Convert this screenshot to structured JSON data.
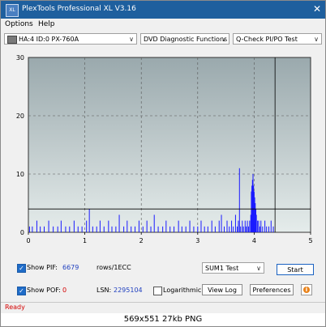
{
  "window": {
    "title": "PlexTools Professional XL V3.16",
    "icon_text": "XL",
    "close_glyph": "✕"
  },
  "menu": {
    "items": [
      "Options",
      "Help"
    ]
  },
  "toolbar": {
    "drive": "HA:4 ID:0  PX-760A",
    "function": "DVD Diagnostic Functions",
    "test": "Q-Check PI/PO Test",
    "arrow": "∨"
  },
  "chart_data": {
    "type": "bar",
    "x_ticks": [
      "0",
      "1",
      "2",
      "3",
      "4",
      "5"
    ],
    "y_ticks": [
      "0",
      "10",
      "20",
      "30"
    ],
    "xlim": [
      0,
      5
    ],
    "ylim": [
      0,
      30
    ],
    "grid": true,
    "reference_line": 4,
    "end_marker_x": 4.37,
    "colors": {
      "bars": "#1a1aff",
      "plot_bg_top": "#9aa9ad",
      "plot_bg_bottom": "#e5eceb",
      "grid": "#555555",
      "ref_line": "#000000"
    },
    "series": [
      {
        "points": [
          [
            0.02,
            1
          ],
          [
            0.07,
            1
          ],
          [
            0.15,
            2
          ],
          [
            0.21,
            1
          ],
          [
            0.28,
            1
          ],
          [
            0.36,
            2
          ],
          [
            0.44,
            1
          ],
          [
            0.52,
            1
          ],
          [
            0.58,
            2
          ],
          [
            0.66,
            1
          ],
          [
            0.73,
            1
          ],
          [
            0.81,
            2
          ],
          [
            0.88,
            1
          ],
          [
            0.95,
            1
          ],
          [
            1.03,
            2
          ],
          [
            1.08,
            4
          ],
          [
            1.14,
            1
          ],
          [
            1.21,
            1
          ],
          [
            1.27,
            2
          ],
          [
            1.34,
            1
          ],
          [
            1.42,
            2
          ],
          [
            1.48,
            1
          ],
          [
            1.55,
            1
          ],
          [
            1.61,
            3
          ],
          [
            1.69,
            1
          ],
          [
            1.75,
            2
          ],
          [
            1.82,
            1
          ],
          [
            1.89,
            1
          ],
          [
            1.96,
            2
          ],
          [
            2.03,
            1
          ],
          [
            2.1,
            2
          ],
          [
            2.17,
            1
          ],
          [
            2.23,
            3
          ],
          [
            2.3,
            1
          ],
          [
            2.38,
            1
          ],
          [
            2.44,
            2
          ],
          [
            2.51,
            1
          ],
          [
            2.58,
            1
          ],
          [
            2.66,
            2
          ],
          [
            2.72,
            1
          ],
          [
            2.79,
            1
          ],
          [
            2.86,
            2
          ],
          [
            2.93,
            1
          ],
          [
            3.0,
            1
          ],
          [
            3.06,
            2
          ],
          [
            3.12,
            1
          ],
          [
            3.18,
            1
          ],
          [
            3.25,
            2
          ],
          [
            3.31,
            1
          ],
          [
            3.38,
            2
          ],
          [
            3.42,
            3
          ],
          [
            3.47,
            1
          ],
          [
            3.52,
            2
          ],
          [
            3.56,
            1
          ],
          [
            3.6,
            2
          ],
          [
            3.63,
            1
          ],
          [
            3.67,
            3
          ],
          [
            3.7,
            1
          ],
          [
            3.72,
            2
          ],
          [
            3.74,
            11
          ],
          [
            3.76,
            1
          ],
          [
            3.79,
            2
          ],
          [
            3.81,
            1
          ],
          [
            3.84,
            2
          ],
          [
            3.86,
            1
          ],
          [
            3.88,
            2
          ],
          [
            3.9,
            1
          ],
          [
            3.92,
            2
          ],
          [
            3.94,
            3
          ],
          [
            3.95,
            7
          ],
          [
            3.96,
            8
          ],
          [
            3.97,
            9
          ],
          [
            3.98,
            10
          ],
          [
            3.99,
            8
          ],
          [
            4.0,
            7
          ],
          [
            4.01,
            6
          ],
          [
            4.02,
            5
          ],
          [
            4.03,
            4
          ],
          [
            4.04,
            3
          ],
          [
            4.06,
            2
          ],
          [
            4.08,
            2
          ],
          [
            4.1,
            1
          ],
          [
            4.12,
            2
          ],
          [
            4.15,
            1
          ],
          [
            4.19,
            2
          ],
          [
            4.22,
            1
          ],
          [
            4.26,
            1
          ],
          [
            4.3,
            2
          ],
          [
            4.34,
            1
          ]
        ]
      }
    ]
  },
  "controls": {
    "show_pif_label": "Show PIF:",
    "pif_value": "6679",
    "pif_unit": "rows/1ECC",
    "show_pof_label": "Show POF:",
    "pof_value": "0",
    "lsn_label": "LSN:",
    "lsn_value": "2295104",
    "logarithmic_label": "Logarithmic",
    "sum_select": "SUM1 Test",
    "start_button": "Start",
    "view_log_button": "View Log",
    "preferences_button": "Preferences",
    "check_glyph": "✓",
    "info_glyph": "i",
    "colors": {
      "pif_value": "#1f3fbf",
      "pof_value": "#d40000",
      "lsn_value": "#1f3fbf"
    }
  },
  "status": {
    "text": "Ready"
  },
  "caption": {
    "text": "569x551  27kb  PNG"
  }
}
